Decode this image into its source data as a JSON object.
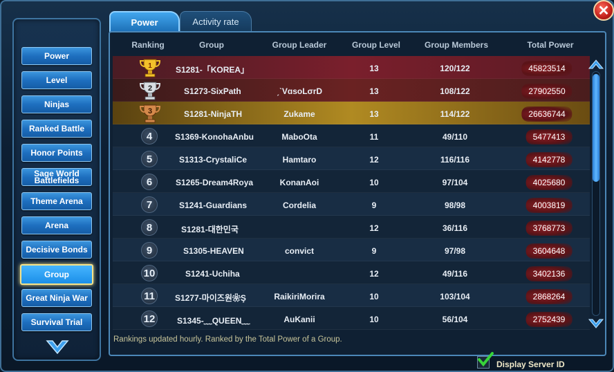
{
  "close": "✕",
  "sidebar": {
    "items": [
      {
        "label": "Power"
      },
      {
        "label": "Level"
      },
      {
        "label": "Ninjas"
      },
      {
        "label": "Ranked Battle"
      },
      {
        "label": "Honor Points"
      },
      {
        "label": "Sage World Battlefields"
      },
      {
        "label": "Theme Arena"
      },
      {
        "label": "Arena"
      },
      {
        "label": "Decisive Bonds"
      },
      {
        "label": "Group"
      },
      {
        "label": "Great Ninja War"
      },
      {
        "label": "Survival Trial"
      }
    ],
    "active": "Group"
  },
  "tabs": [
    {
      "label": "Power",
      "active": true
    },
    {
      "label": "Activity rate",
      "active": false
    }
  ],
  "table": {
    "headers": [
      "Ranking",
      "Group",
      "Group Leader",
      "Group Level",
      "Group Members",
      "Total Power"
    ],
    "rows": [
      {
        "rank": "1",
        "group": "S1281-「KOREA」",
        "leader": "",
        "level": "13",
        "members": "120/122",
        "power": "45823514"
      },
      {
        "rank": "2",
        "group": "S1273-SixPath",
        "leader": "ˏˋVɑsoLσrD",
        "level": "13",
        "members": "108/122",
        "power": "27902550"
      },
      {
        "rank": "3",
        "group": "S1281-NinjaTH",
        "leader": "Zukame",
        "level": "13",
        "members": "114/122",
        "power": "26636744"
      },
      {
        "rank": "4",
        "group": "S1369-KonohaAnbu",
        "leader": "MaboOta",
        "level": "11",
        "members": "49/110",
        "power": "5477413"
      },
      {
        "rank": "5",
        "group": "S1313-CrystaliCe",
        "leader": "Hamtaro",
        "level": "12",
        "members": "116/116",
        "power": "4142778"
      },
      {
        "rank": "6",
        "group": "S1265-Dream4Roya",
        "leader": "KonanAoi",
        "level": "10",
        "members": "97/104",
        "power": "4025680"
      },
      {
        "rank": "7",
        "group": "S1241-Guardians",
        "leader": "Cordelia",
        "level": "9",
        "members": "98/98",
        "power": "4003819"
      },
      {
        "rank": "8",
        "group": "S1281-대한민국",
        "leader": "",
        "level": "12",
        "members": "36/116",
        "power": "3768773"
      },
      {
        "rank": "9",
        "group": "S1305-HEAVEN",
        "leader": "convict",
        "level": "9",
        "members": "97/98",
        "power": "3604648"
      },
      {
        "rank": "10",
        "group": "S1241-Uchiha",
        "leader": "",
        "level": "12",
        "members": "49/116",
        "power": "3402136"
      },
      {
        "rank": "11",
        "group": "S1277-마이즈원❀Ş",
        "leader": "RaikiriMorira",
        "level": "10",
        "members": "103/104",
        "power": "2868264"
      },
      {
        "rank": "12",
        "group": "S1345-﹏QUEEN﹏",
        "leader": "AuKanii",
        "level": "10",
        "members": "56/104",
        "power": "2752439"
      }
    ]
  },
  "footnote": "Rankings updated hourly. Ranked by the Total Power of a Group.",
  "display_server_id": {
    "label": "Display Server ID",
    "checked": true
  },
  "colors": {
    "accent": "#1e6fbf",
    "gold": "#f5e38a",
    "power_badge": "#8c1e25"
  }
}
